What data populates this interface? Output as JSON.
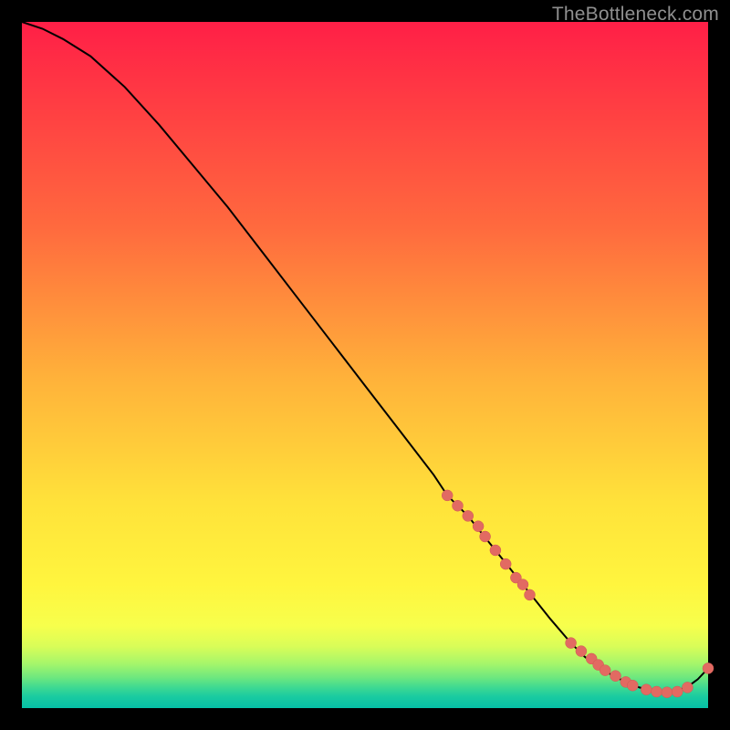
{
  "watermark": "TheBottleneck.com",
  "colors": {
    "marker_fill": "#e26a62",
    "marker_stroke": "#cf5a52",
    "curve_stroke": "#000000"
  },
  "chart_data": {
    "type": "line",
    "title": "",
    "xlabel": "",
    "ylabel": "",
    "xlim": [
      0,
      100
    ],
    "ylim": [
      0,
      100
    ],
    "grid": false,
    "legend": false,
    "series": [
      {
        "name": "curve",
        "x": [
          0,
          3,
          6,
          10,
          15,
          20,
          25,
          30,
          35,
          40,
          45,
          50,
          55,
          60,
          62,
          65,
          67,
          69,
          71,
          73,
          75,
          77,
          80,
          82,
          84,
          86,
          88,
          90,
          92,
          93,
          95,
          97,
          98.5,
          100
        ],
        "values": [
          100,
          99,
          97.5,
          95,
          90.5,
          85,
          79,
          73,
          66.5,
          60,
          53.5,
          47,
          40.5,
          34,
          31,
          28,
          25.5,
          23,
          20.5,
          18,
          15.5,
          13,
          9.5,
          7.5,
          6,
          4.8,
          3.8,
          3,
          2.5,
          2.3,
          2.4,
          3.1,
          4.2,
          5.8
        ]
      }
    ],
    "markers": {
      "name": "dots",
      "x": [
        62,
        63.5,
        65,
        66.5,
        67.5,
        69,
        70.5,
        72,
        73,
        74,
        80,
        81.5,
        83,
        84,
        85,
        86.5,
        88,
        89,
        91,
        92.5,
        94,
        95.5,
        97,
        100
      ],
      "values": [
        31,
        29.5,
        28,
        26.5,
        25,
        23,
        21,
        19,
        18,
        16.5,
        9.5,
        8.3,
        7.2,
        6.3,
        5.5,
        4.7,
        3.8,
        3.3,
        2.7,
        2.4,
        2.3,
        2.4,
        3.0,
        5.8
      ]
    }
  }
}
